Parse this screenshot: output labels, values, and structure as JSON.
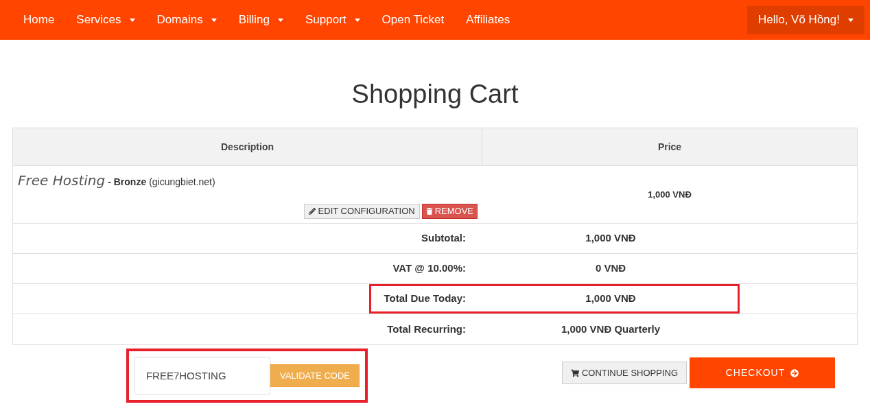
{
  "nav": {
    "items": [
      {
        "label": "Home",
        "dropdown": false
      },
      {
        "label": "Services",
        "dropdown": true
      },
      {
        "label": "Domains",
        "dropdown": true
      },
      {
        "label": "Billing",
        "dropdown": true
      },
      {
        "label": "Support",
        "dropdown": true
      },
      {
        "label": "Open Ticket",
        "dropdown": false
      },
      {
        "label": "Affiliates",
        "dropdown": false
      }
    ],
    "user_menu": "Hello, Võ Hồng!"
  },
  "title": "Shopping Cart",
  "table": {
    "columns": [
      "Description",
      "Price"
    ],
    "item": {
      "product": "Free Hosting",
      "plan": "- Bronze",
      "domain": "(gicungbiet.net)",
      "price": "1,000 VNĐ",
      "edit_button": "EDIT CONFIGURATION",
      "remove_button": "REMOVE"
    },
    "totals": [
      {
        "label": "Subtotal:",
        "value": "1,000 VNĐ",
        "highlighted": false
      },
      {
        "label": "VAT @ 10.00%:",
        "value": "0 VNĐ",
        "highlighted": false
      },
      {
        "label": "Total Due Today:",
        "value": "1,000 VNĐ",
        "highlighted": true
      },
      {
        "label": "Total Recurring:",
        "value": "1,000 VNĐ Quarterly",
        "highlighted": false
      }
    ]
  },
  "promo": {
    "value": "FREE7HOSTING",
    "button": "VALIDATE CODE",
    "highlighted": true
  },
  "continue_button": "CONTINUE SHOPPING",
  "checkout_button": "CHECKOUT"
}
